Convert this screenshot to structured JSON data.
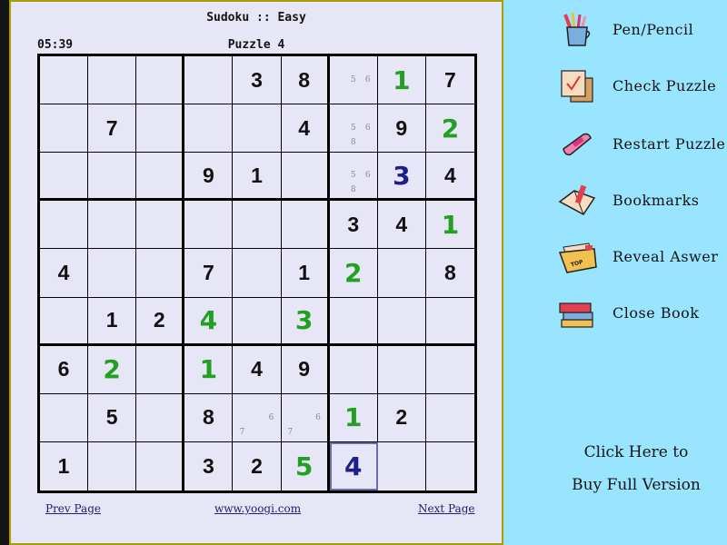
{
  "header": {
    "title": "Sudoku :: Easy",
    "timer": "05:39",
    "puzzle_label": "Puzzle 4"
  },
  "grid": {
    "rows": [
      [
        {
          "v": ""
        },
        {
          "v": ""
        },
        {
          "v": ""
        },
        {
          "v": ""
        },
        {
          "v": "3",
          "t": "given"
        },
        {
          "v": "8",
          "t": "given"
        },
        {
          "v": "",
          "notes": [
            "5",
            "6"
          ]
        },
        {
          "v": "1",
          "t": "user"
        },
        {
          "v": "7",
          "t": "given"
        }
      ],
      [
        {
          "v": ""
        },
        {
          "v": "7",
          "t": "given"
        },
        {
          "v": ""
        },
        {
          "v": ""
        },
        {
          "v": ""
        },
        {
          "v": "4",
          "t": "given"
        },
        {
          "v": "",
          "notes": [
            "5",
            "6",
            "8"
          ]
        },
        {
          "v": "9",
          "t": "given"
        },
        {
          "v": "2",
          "t": "user"
        }
      ],
      [
        {
          "v": ""
        },
        {
          "v": ""
        },
        {
          "v": ""
        },
        {
          "v": "9",
          "t": "given"
        },
        {
          "v": "1",
          "t": "given"
        },
        {
          "v": ""
        },
        {
          "v": "",
          "notes": [
            "5",
            "6",
            "8"
          ]
        },
        {
          "v": "3",
          "t": "hint"
        },
        {
          "v": "4",
          "t": "given"
        }
      ],
      [
        {
          "v": ""
        },
        {
          "v": ""
        },
        {
          "v": ""
        },
        {
          "v": ""
        },
        {
          "v": ""
        },
        {
          "v": ""
        },
        {
          "v": "3",
          "t": "given"
        },
        {
          "v": "4",
          "t": "given"
        },
        {
          "v": "1",
          "t": "user"
        }
      ],
      [
        {
          "v": "4",
          "t": "given"
        },
        {
          "v": ""
        },
        {
          "v": ""
        },
        {
          "v": "7",
          "t": "given"
        },
        {
          "v": ""
        },
        {
          "v": "1",
          "t": "given"
        },
        {
          "v": "2",
          "t": "user"
        },
        {
          "v": ""
        },
        {
          "v": "8",
          "t": "given"
        }
      ],
      [
        {
          "v": ""
        },
        {
          "v": "1",
          "t": "given"
        },
        {
          "v": "2",
          "t": "given"
        },
        {
          "v": "4",
          "t": "user"
        },
        {
          "v": ""
        },
        {
          "v": "3",
          "t": "user"
        },
        {
          "v": ""
        },
        {
          "v": ""
        },
        {
          "v": ""
        }
      ],
      [
        {
          "v": "6",
          "t": "given"
        },
        {
          "v": "2",
          "t": "user"
        },
        {
          "v": ""
        },
        {
          "v": "1",
          "t": "user"
        },
        {
          "v": "4",
          "t": "given"
        },
        {
          "v": "9",
          "t": "given"
        },
        {
          "v": ""
        },
        {
          "v": ""
        },
        {
          "v": ""
        }
      ],
      [
        {
          "v": ""
        },
        {
          "v": "5",
          "t": "given"
        },
        {
          "v": ""
        },
        {
          "v": "8",
          "t": "given"
        },
        {
          "v": "",
          "notes": [
            "6",
            "7"
          ]
        },
        {
          "v": "",
          "notes": [
            "6",
            "7"
          ]
        },
        {
          "v": "1",
          "t": "user"
        },
        {
          "v": "2",
          "t": "given"
        },
        {
          "v": ""
        }
      ],
      [
        {
          "v": "1",
          "t": "given"
        },
        {
          "v": ""
        },
        {
          "v": ""
        },
        {
          "v": "3",
          "t": "given"
        },
        {
          "v": "2",
          "t": "given"
        },
        {
          "v": "5",
          "t": "user"
        },
        {
          "v": "4",
          "t": "hint",
          "selected": true
        },
        {
          "v": ""
        },
        {
          "v": ""
        }
      ]
    ]
  },
  "footer": {
    "prev": "Prev Page",
    "site": "www.yoogi.com",
    "next": "Next Page"
  },
  "menu": [
    {
      "label": "Pen/Pencil",
      "icon": "pencil-cup-icon"
    },
    {
      "label": "Check Puzzle",
      "icon": "checklist-icon"
    },
    {
      "label": "Restart Puzzle",
      "icon": "eraser-icon"
    },
    {
      "label": "Bookmarks",
      "icon": "bookmark-book-icon"
    },
    {
      "label": "Reveal Aswer",
      "icon": "top-secret-folder-icon"
    },
    {
      "label": "Close Book",
      "icon": "book-stack-icon"
    }
  ],
  "buy": {
    "line1": "Click Here to",
    "line2": "Buy Full Version"
  },
  "colors": {
    "user_digit": "#22a022",
    "hint_digit": "#1e1e8c",
    "page_bg": "#e6e6f6",
    "side_bg": "#99e4fe",
    "frame": "#a8a000"
  }
}
